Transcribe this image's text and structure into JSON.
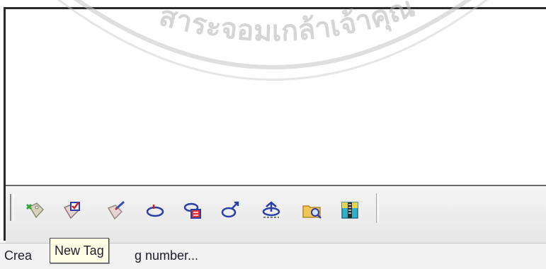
{
  "watermark": {
    "text": "สาระจอมเกล้าเจ้าคุณ"
  },
  "toolbar": {
    "buttons": [
      {
        "name": "tag-icon",
        "tooltip": ""
      },
      {
        "name": "new-tag-icon",
        "tooltip": "New Tag"
      },
      {
        "name": "edit-tag-icon",
        "tooltip": ""
      },
      {
        "name": "loop-icon",
        "tooltip": ""
      },
      {
        "name": "tag-stack-icon",
        "tooltip": ""
      },
      {
        "name": "curve-arrow-icon",
        "tooltip": ""
      },
      {
        "name": "upload-icon",
        "tooltip": ""
      },
      {
        "name": "folder-search-icon",
        "tooltip": ""
      },
      {
        "name": "zip-archive-icon",
        "tooltip": ""
      }
    ]
  },
  "tooltip": {
    "text": "New Tag"
  },
  "statusbar": {
    "prefix": "Crea",
    "suffix": "g number..."
  },
  "colors": {
    "tooltip_bg": "#ffffe6",
    "frame": "#2a2a2a",
    "watermark": "#b4b4b4"
  }
}
